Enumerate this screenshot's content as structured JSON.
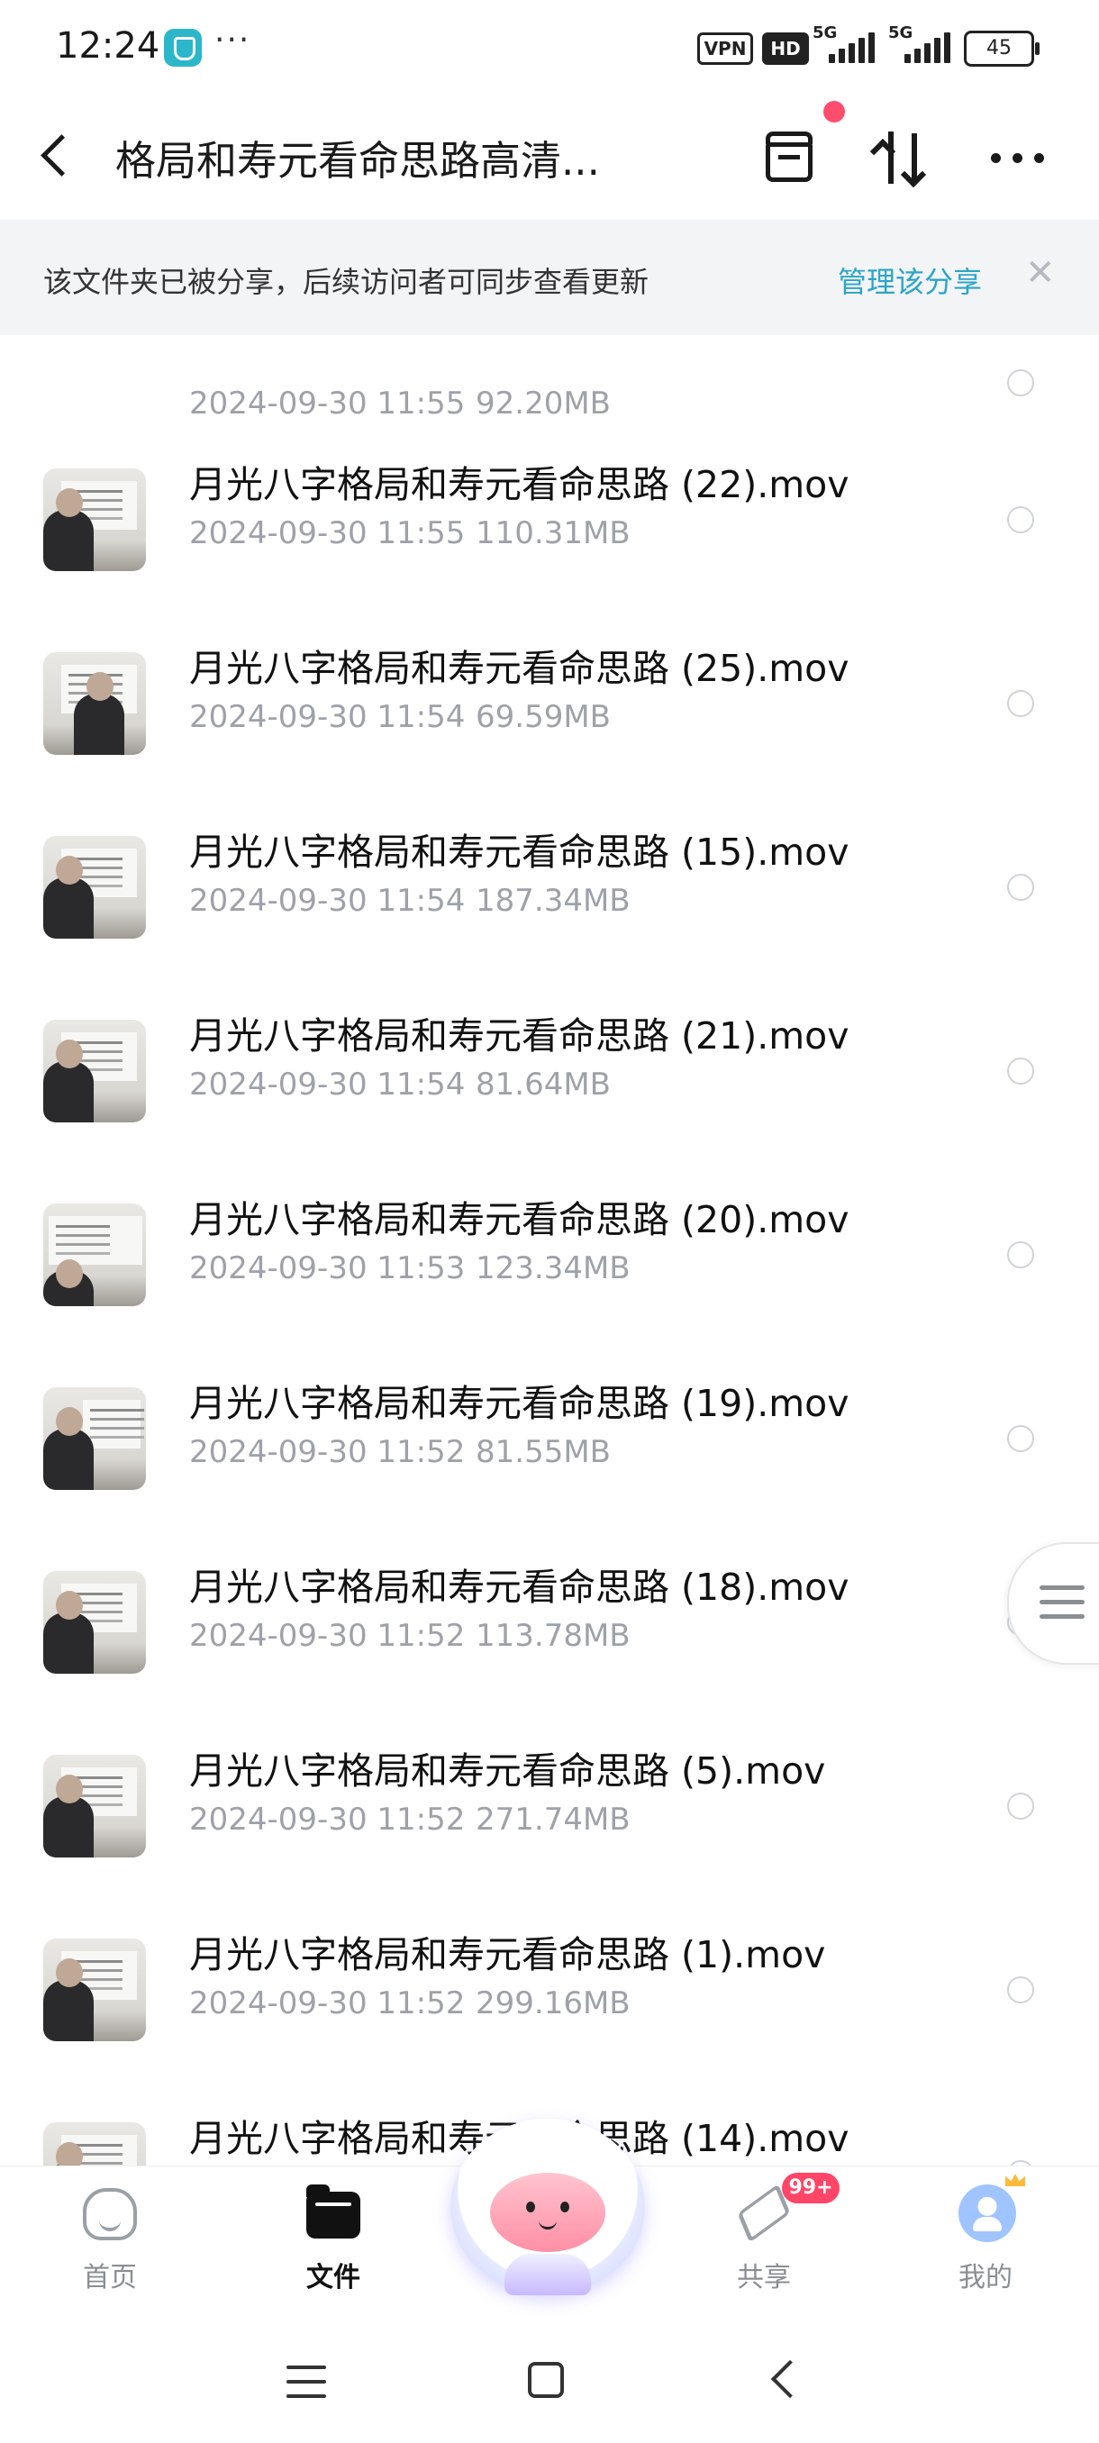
{
  "status_bar": {
    "time": "12:24",
    "more": "···",
    "vpn": "VPN",
    "hd": "HD",
    "net1": "5G",
    "net2": "5G",
    "battery": "45"
  },
  "header": {
    "title": "格局和寿元看命思路高清...",
    "icons": [
      "back-icon",
      "archive-icon",
      "sort-icon",
      "more-icon"
    ]
  },
  "banner": {
    "text": "该文件夹已被分享，后续访问者可同步查看更新",
    "link": "管理该分享",
    "close": "✕"
  },
  "files": [
    {
      "name": "",
      "date": "2024-09-30  11:55",
      "size": "92.20MB"
    },
    {
      "name": "月光八字格局和寿元看命思路 (22).mov",
      "date": "2024-09-30  11:55",
      "size": "110.31MB"
    },
    {
      "name": "月光八字格局和寿元看命思路 (25).mov",
      "date": "2024-09-30  11:54",
      "size": "69.59MB"
    },
    {
      "name": "月光八字格局和寿元看命思路 (15).mov",
      "date": "2024-09-30  11:54",
      "size": "187.34MB"
    },
    {
      "name": "月光八字格局和寿元看命思路 (21).mov",
      "date": "2024-09-30  11:54",
      "size": "81.64MB"
    },
    {
      "name": "月光八字格局和寿元看命思路 (20).mov",
      "date": "2024-09-30  11:53",
      "size": "123.34MB"
    },
    {
      "name": "月光八字格局和寿元看命思路 (19).mov",
      "date": "2024-09-30  11:52",
      "size": "81.55MB"
    },
    {
      "name": "月光八字格局和寿元看命思路 (18).mov",
      "date": "2024-09-30  11:52",
      "size": "113.78MB"
    },
    {
      "name": "月光八字格局和寿元看命思路 (5).mov",
      "date": "2024-09-30  11:52",
      "size": "271.74MB"
    },
    {
      "name": "月光八字格局和寿元看命思路 (1).mov",
      "date": "2024-09-30  11:52",
      "size": "299.16MB"
    },
    {
      "name": "月光八字格局和寿元看命思路 (14).mov",
      "date": "",
      "size": ""
    }
  ],
  "bottom_nav": {
    "items": [
      {
        "label": "首页",
        "icon": "home-icon"
      },
      {
        "label": "文件",
        "icon": "folder-icon",
        "active": true
      },
      {
        "label": "共享",
        "icon": "send-icon",
        "badge": "99+"
      },
      {
        "label": "我的",
        "icon": "avatar-icon"
      }
    ]
  },
  "colors": {
    "accent": "#2ba5c8",
    "badge": "#ff4668",
    "banner_bg": "#f3f4f6",
    "meta_text": "#9ea2a8"
  }
}
